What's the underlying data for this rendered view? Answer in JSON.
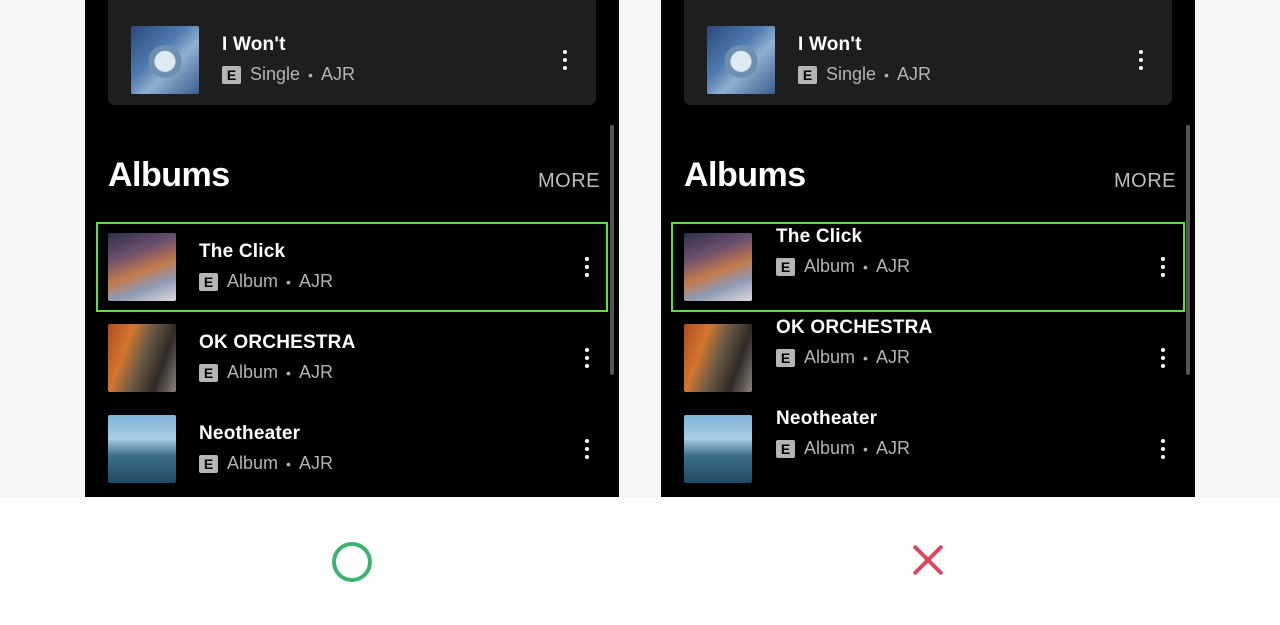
{
  "single": {
    "title": "I Won't",
    "badge": "E",
    "kind": "Single",
    "sep": "•",
    "artist": "AJR"
  },
  "section": {
    "title": "Albums",
    "more": "MORE"
  },
  "albums": [
    {
      "title": "The Click",
      "badge": "E",
      "kind": "Album",
      "sep": "•",
      "artist": "AJR",
      "art": "the-click-album-art"
    },
    {
      "title": "OK ORCHESTRA",
      "badge": "E",
      "kind": "Album",
      "sep": "•",
      "artist": "AJR",
      "art": "ok-orchestra-album-art"
    },
    {
      "title": "Neotheater",
      "badge": "E",
      "kind": "Album",
      "sep": "•",
      "artist": "AJR",
      "art": "neotheater-album-art"
    }
  ],
  "colors": {
    "highlight": "#58e33a",
    "correct": "#3cb371",
    "wrong": "#e0445e"
  },
  "marks": {
    "left": "circle-correct-icon",
    "right": "cross-wrong-icon"
  }
}
